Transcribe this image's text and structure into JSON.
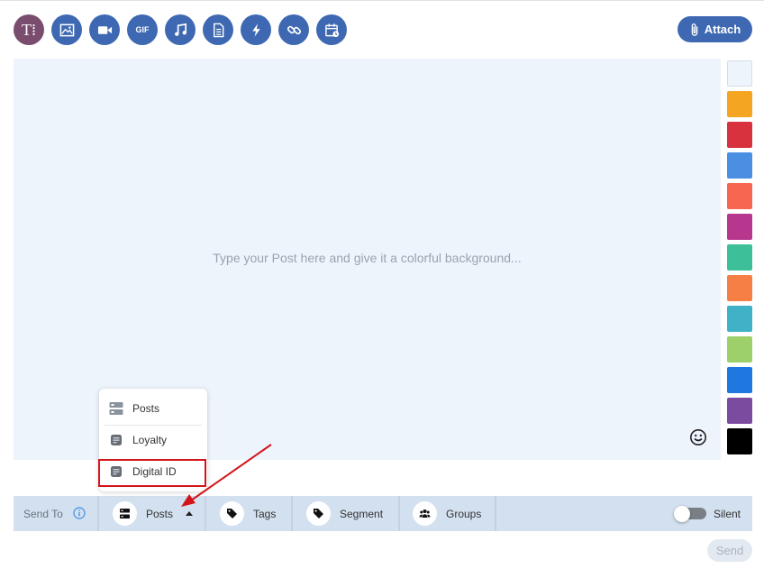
{
  "toolbar": {
    "buttons": [
      {
        "icon": "text-format-icon",
        "glyph": "T⁞"
      },
      {
        "icon": "image-icon"
      },
      {
        "icon": "video-icon"
      },
      {
        "icon": "gif-icon",
        "glyph": "GIF"
      },
      {
        "icon": "music-icon"
      },
      {
        "icon": "document-icon"
      },
      {
        "icon": "lightning-icon"
      },
      {
        "icon": "link-icon"
      },
      {
        "icon": "calendar-schedule-icon"
      }
    ],
    "attach_label": "Attach"
  },
  "editor": {
    "placeholder": "Type your Post here and give it a colorful background..."
  },
  "palette": {
    "colors": [
      "#eef4fc",
      "#f4a623",
      "#d8323e",
      "#4a8fe2",
      "#f76650",
      "#b8378e",
      "#3dc09a",
      "#f57f45",
      "#3fb2c8",
      "#9dd06a",
      "#1e78e0",
      "#7b4ba0",
      "#000000"
    ]
  },
  "dropdown": {
    "items": [
      {
        "label": "Posts",
        "icon": "server-icon"
      },
      {
        "label": "Loyalty",
        "icon": "card-icon"
      },
      {
        "label": "Digital ID",
        "icon": "card-icon"
      }
    ]
  },
  "sendbar": {
    "send_to_label": "Send To",
    "posts_label": "Posts",
    "tags_label": "Tags",
    "segment_label": "Segment",
    "groups_label": "Groups",
    "silent_label": "Silent"
  },
  "send_label": "Send"
}
